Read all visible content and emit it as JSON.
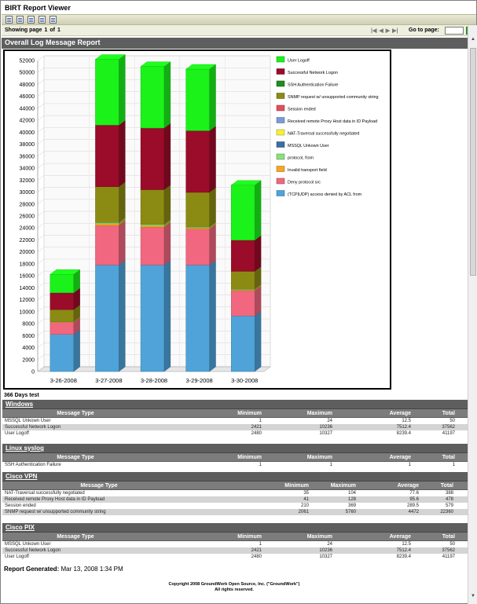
{
  "window": {
    "title": "BIRT Report Viewer"
  },
  "toolbar": {
    "icons": [
      "toc-icon",
      "run-report-icon",
      "export-data-icon",
      "export-report-icon",
      "print-icon"
    ]
  },
  "nav": {
    "showing_label": "Showing page",
    "page": "1",
    "of_label": "of",
    "total": "1",
    "goto_label": "Go to page:",
    "goto_value": "",
    "go_button": "▶"
  },
  "report": {
    "title": "Overall Log Message Report"
  },
  "chart_data": {
    "type": "bar",
    "stacked": true,
    "categories": [
      "3-26-2008",
      "3-27-2008",
      "3-28-2008",
      "3-29-2008",
      "3-30-2008"
    ],
    "ylim": [
      0,
      52000
    ],
    "yticks": [
      "0",
      "2000",
      "4000",
      "6000",
      "8000",
      "10000",
      "12000",
      "14000",
      "16000",
      "18000",
      "20000",
      "22000",
      "24000",
      "26000",
      "28000",
      "30000",
      "32000",
      "34000",
      "36000",
      "38000",
      "40000",
      "42000",
      "44000",
      "46000",
      "48000",
      "50000",
      "52000"
    ],
    "series": [
      {
        "name": "(TCP|UDP) access denied by ACL from",
        "color": "#4fa3d9",
        "values": [
          6200,
          17800,
          17800,
          17800,
          9300
        ]
      },
      {
        "name": "Deny protocol src",
        "color": "#f0677f",
        "values": [
          2000,
          6600,
          6300,
          6000,
          4200
        ]
      },
      {
        "name": "Invalid transport field",
        "color": "#f5a623",
        "values": [
          100,
          300,
          300,
          200,
          150
        ]
      },
      {
        "name": "protocol, from",
        "color": "#8ddf7d",
        "values": [
          50,
          200,
          200,
          150,
          100
        ]
      },
      {
        "name": "MSSQL Unkown User",
        "color": "#3a6ea5",
        "values": [
          0,
          0,
          0,
          0,
          0
        ]
      },
      {
        "name": "NAT-Traversal successfully negotiated",
        "color": "#f5f03a",
        "values": [
          0,
          0,
          0,
          0,
          0
        ]
      },
      {
        "name": "Received remote Proxy Host data in ID Payload",
        "color": "#7a9cd6",
        "values": [
          0,
          0,
          0,
          0,
          0
        ]
      },
      {
        "name": "Session ended",
        "color": "#e0505a",
        "values": [
          0,
          0,
          0,
          0,
          0
        ]
      },
      {
        "name": "SNMP request w/ unsupported community string",
        "color": "#8b8b13",
        "values": [
          2000,
          6000,
          5800,
          5800,
          3000
        ]
      },
      {
        "name": "SSH Authentication Failure",
        "color": "#1e8c1e",
        "values": [
          0,
          0,
          0,
          0,
          0
        ]
      },
      {
        "name": "Successful Network Logon",
        "color": "#9b0b2a",
        "values": [
          2800,
          10300,
          10300,
          10300,
          5200
        ]
      },
      {
        "name": "User Logoff",
        "color": "#1af21a",
        "values": [
          3100,
          11000,
          10300,
          10300,
          9200
        ]
      }
    ]
  },
  "section": {
    "title": "366 Days test"
  },
  "columns": {
    "type": "Message Type",
    "min": "Minimum",
    "max": "Maximum",
    "avg": "Average",
    "total": "Total"
  },
  "groups": [
    {
      "name": "Windows",
      "rows": [
        {
          "type": "MSSQL Unkown User",
          "min": "1",
          "max": "24",
          "avg": "12.5",
          "total": "50"
        },
        {
          "type": "Successful Network Logon",
          "min": "2421",
          "max": "10236",
          "avg": "7512.4",
          "total": "37562"
        },
        {
          "type": "User Logoff",
          "min": "2480",
          "max": "10327",
          "avg": "8239.4",
          "total": "41197"
        }
      ]
    },
    {
      "name": "Linux syslog",
      "rows": [
        {
          "type": "SSH Authentication Failure",
          "min": "1",
          "max": "1",
          "avg": "1",
          "total": "1"
        }
      ]
    },
    {
      "name": "Cisco VPN",
      "rows": [
        {
          "type": "NAT-Traversal successfully negotiated",
          "min": "35",
          "max": "104",
          "avg": "77.6",
          "total": "388"
        },
        {
          "type": "Received remote Proxy Host data in ID Payload",
          "min": "41",
          "max": "128",
          "avg": "95.6",
          "total": "478"
        },
        {
          "type": "Session ended",
          "min": "210",
          "max": "369",
          "avg": "289.5",
          "total": "579"
        },
        {
          "type": "SNMP request w/ unsupported community string",
          "min": "2061",
          "max": "5760",
          "avg": "4472",
          "total": "22360"
        }
      ]
    },
    {
      "name": "Cisco PIX",
      "rows": [
        {
          "type": "MSSQL Unkown User",
          "min": "1",
          "max": "24",
          "avg": "12.5",
          "total": "50"
        },
        {
          "type": "Successful Network Logon",
          "min": "2421",
          "max": "10236",
          "avg": "7512.4",
          "total": "37562"
        },
        {
          "type": "User Logoff",
          "min": "2480",
          "max": "10327",
          "avg": "8239.4",
          "total": "41197"
        }
      ]
    }
  ],
  "footer": {
    "generated_label": "Report Generated:",
    "generated_value": "Mar 13, 2008 1:34 PM",
    "copyright_1": "Copyright 2008 GroundWork Open Source, Inc. (\"GroundWork\")",
    "copyright_2": "All rights reserved."
  }
}
